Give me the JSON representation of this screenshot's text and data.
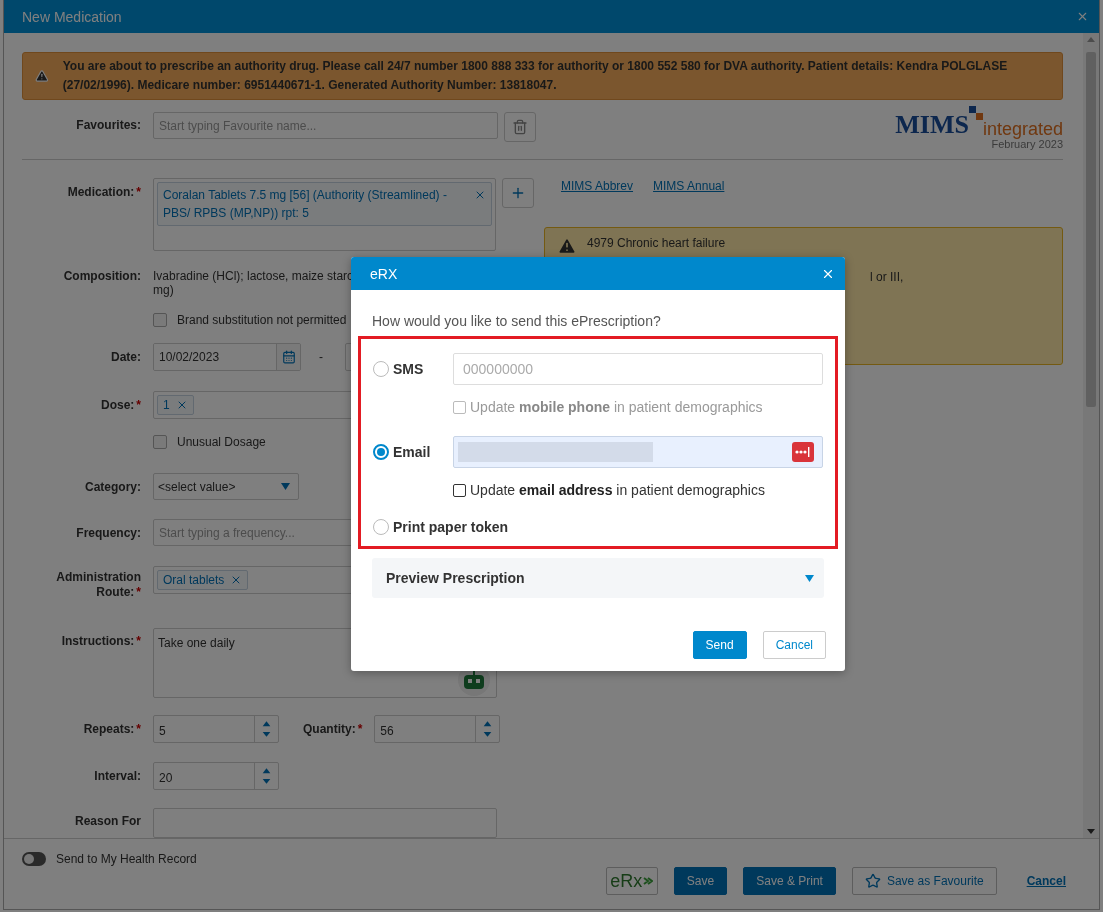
{
  "window": {
    "title": "New Medication"
  },
  "alert": {
    "text": "You are about to prescribe an authority drug. Please call 24/7 number 1800 888 333 for authority or 1800 552 580 for DVA authority. Patient details: Kendra POLGLASE (27/02/1996). Medicare number: 6951440671-1. Generated Authority Number: 13818047."
  },
  "favourites": {
    "label": "Favourites:",
    "placeholder": "Start typing Favourite name..."
  },
  "logo": {
    "brand": "MIMS",
    "suffix": "integrated",
    "edition": "February 2023"
  },
  "links": [
    "MIMS Abbrev",
    "MIMS Annual"
  ],
  "warning": {
    "title": "4979 Chronic heart failure",
    "fragment": "l or III,"
  },
  "form": {
    "medication": {
      "label": "Medication:",
      "mark": "*",
      "tag": "Coralan Tablets 7.5 mg [56] (Authority (Streamlined) - PBS/ RPBS (MP,NP)) rpt: 5"
    },
    "composition": {
      "label": "Composition:",
      "lines": [
        "Ivabradine (HCl); lactose, maize starc",
        "mg)"
      ]
    },
    "brand_substitution": {
      "label": "Brand substitution not permitted",
      "checked": false
    },
    "date": {
      "label": "Date:",
      "value": "10/02/2023",
      "separator": "-"
    },
    "dose": {
      "label": "Dose:",
      "mark": "*",
      "tag": "1"
    },
    "unusual_dosage": {
      "label": "Unusual Dosage",
      "checked": false
    },
    "category": {
      "label": "Category:",
      "value": "<select value>"
    },
    "frequency": {
      "label": "Frequency:",
      "placeholder": "Start typing a frequency..."
    },
    "route": {
      "label": "Administration Route:",
      "mark": "*",
      "tag": "Oral tablets"
    },
    "instructions": {
      "label": "Instructions:",
      "mark": "*",
      "value": "Take one daily"
    },
    "repeats": {
      "label": "Repeats:",
      "mark": "*",
      "value": "5"
    },
    "quantity": {
      "label": "Quantity:",
      "mark": "*",
      "value": "56"
    },
    "interval": {
      "label": "Interval:",
      "value": "20"
    },
    "reason": {
      "label": "Reason For"
    }
  },
  "footer": {
    "toggle": {
      "label": "Send to My Health Record",
      "on": false
    },
    "erx": "eRx",
    "buttons": [
      {
        "label": "Save",
        "kind": "primary"
      },
      {
        "label": "Save & Print",
        "kind": "primary"
      },
      {
        "label": "Save as Favourite",
        "kind": "outline"
      }
    ],
    "cancel": "Cancel"
  },
  "modal": {
    "title": "eRX",
    "question": "How would you like to send this ePrescription?",
    "options": [
      {
        "kind": "sms",
        "label": "SMS",
        "selected": false,
        "placeholder": "000000000",
        "update": {
          "text": "Update **mobile phone** in patient demographics",
          "checked": false,
          "disabled": true
        }
      },
      {
        "kind": "email",
        "label": "Email",
        "selected": true,
        "update": {
          "text": "Update **email address** in patient demographics",
          "checked": false,
          "disabled": false
        }
      },
      {
        "kind": "paper",
        "label": "Print paper token",
        "selected": false
      }
    ],
    "preview": {
      "label": "Preview Prescription",
      "expanded": false
    },
    "send": "Send",
    "cancel": "Cancel"
  }
}
